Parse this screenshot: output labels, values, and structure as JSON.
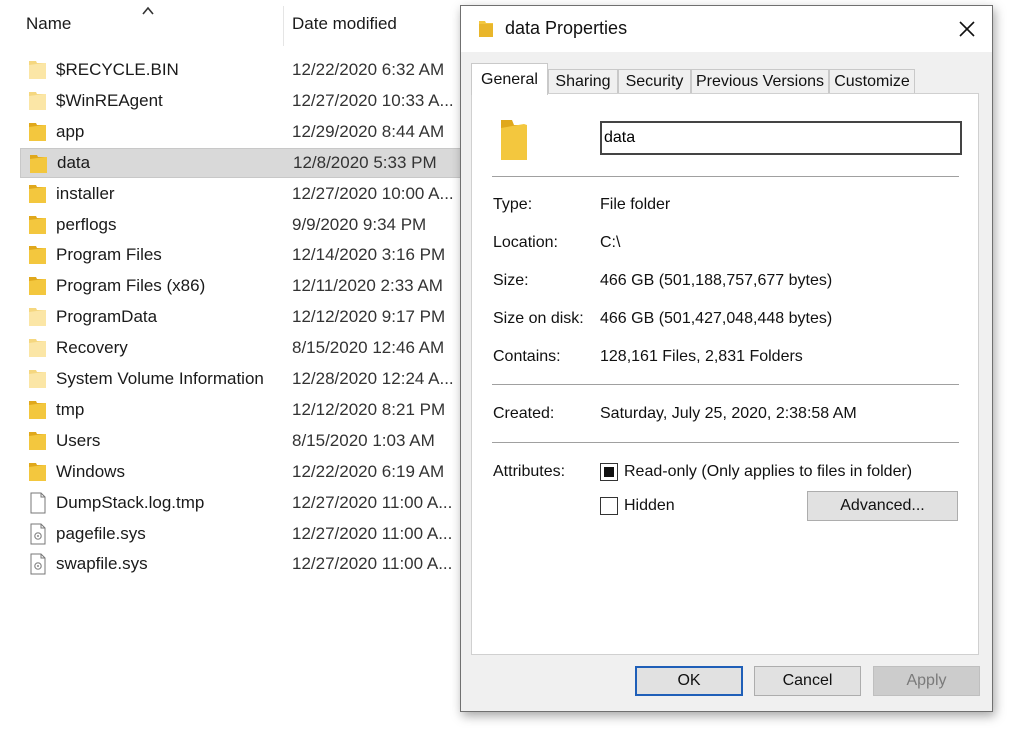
{
  "explorer": {
    "columns": {
      "name": "Name",
      "date": "Date modified"
    },
    "rows": [
      {
        "name": "$RECYCLE.BIN",
        "date": "12/22/2020 6:32 AM",
        "icon": "folder-hidden-icon"
      },
      {
        "name": "$WinREAgent",
        "date": "12/27/2020 10:33 A...",
        "icon": "folder-hidden-icon"
      },
      {
        "name": "app",
        "date": "12/29/2020 8:44 AM",
        "icon": "folder-icon"
      },
      {
        "name": "data",
        "date": "12/8/2020 5:33 PM",
        "icon": "folder-icon",
        "selected": true
      },
      {
        "name": "installer",
        "date": "12/27/2020 10:00 A...",
        "icon": "folder-icon"
      },
      {
        "name": "perflogs",
        "date": "9/9/2020 9:34 PM",
        "icon": "folder-icon"
      },
      {
        "name": "Program Files",
        "date": "12/14/2020 3:16 PM",
        "icon": "folder-icon"
      },
      {
        "name": "Program Files (x86)",
        "date": "12/11/2020 2:33 AM",
        "icon": "folder-icon"
      },
      {
        "name": "ProgramData",
        "date": "12/12/2020 9:17 PM",
        "icon": "folder-hidden-icon"
      },
      {
        "name": "Recovery",
        "date": "8/15/2020 12:46 AM",
        "icon": "folder-hidden-icon"
      },
      {
        "name": "System Volume Information",
        "date": "12/28/2020 12:24 A...",
        "icon": "folder-hidden-icon"
      },
      {
        "name": "tmp",
        "date": "12/12/2020 8:21 PM",
        "icon": "folder-icon"
      },
      {
        "name": "Users",
        "date": "8/15/2020 1:03 AM",
        "icon": "folder-icon"
      },
      {
        "name": "Windows",
        "date": "12/22/2020 6:19 AM",
        "icon": "folder-icon"
      },
      {
        "name": "DumpStack.log.tmp",
        "date": "12/27/2020 11:00 A...",
        "icon": "file-icon"
      },
      {
        "name": "pagefile.sys",
        "date": "12/27/2020 11:00 A...",
        "icon": "system-file-icon"
      },
      {
        "name": "swapfile.sys",
        "date": "12/27/2020 11:00 A...",
        "icon": "system-file-icon"
      }
    ]
  },
  "dialog": {
    "title": "data Properties",
    "tabs": [
      "General",
      "Sharing",
      "Security",
      "Previous Versions",
      "Customize"
    ],
    "active_tab": "General",
    "folder_name": "data",
    "props": {
      "type_label": "Type:",
      "type_value": "File folder",
      "location_label": "Location:",
      "location_value": "C:\\",
      "size_label": "Size:",
      "size_value": "466 GB (501,188,757,677 bytes)",
      "size_on_disk_label": "Size on disk:",
      "size_on_disk_value": "466 GB (501,427,048,448 bytes)",
      "contains_label": "Contains:",
      "contains_value": "128,161 Files, 2,831 Folders",
      "created_label": "Created:",
      "created_value": "Saturday, July 25, 2020, 2:38:58 AM",
      "attributes_label": "Attributes:"
    },
    "attributes": {
      "readonly_label": "Read-only (Only applies to files in folder)",
      "readonly_state": "indeterminate",
      "hidden_label": "Hidden",
      "hidden_checked": false,
      "advanced_label": "Advanced..."
    },
    "buttons": {
      "ok": "OK",
      "cancel": "Cancel",
      "apply": "Apply"
    }
  },
  "colors": {
    "folder": "#f3c73e",
    "folder_dark": "#e0a81c",
    "folder_hidden": "#fbe6a6",
    "selection": "#d9d9d9",
    "default_button_border": "#1f5fb8"
  }
}
